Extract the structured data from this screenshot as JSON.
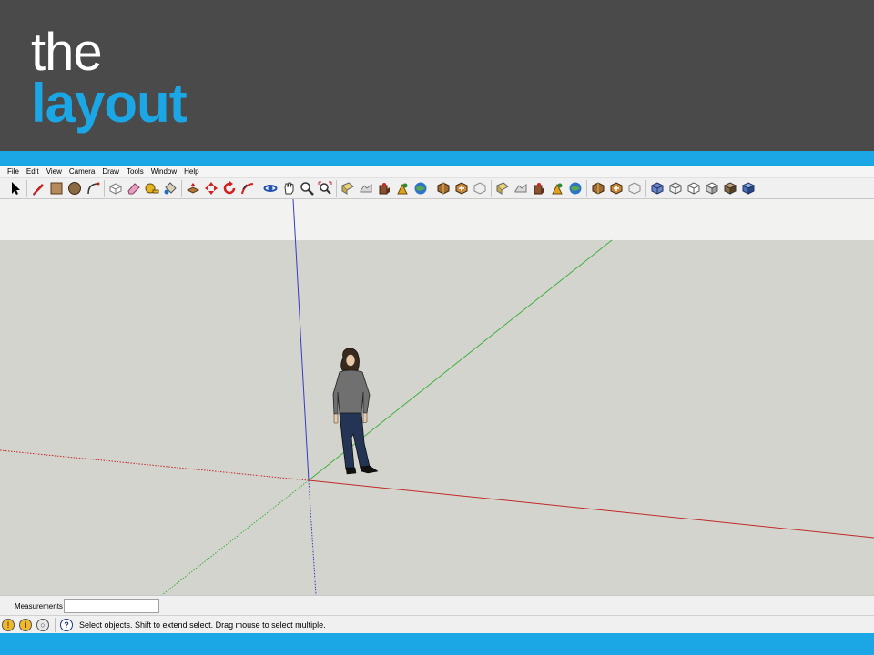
{
  "slide": {
    "title_line1": "the",
    "title_line2": "layout",
    "accent_color": "#1ba7e6",
    "background_color": "#4a4a4a"
  },
  "menubar": {
    "items": [
      "File",
      "Edit",
      "View",
      "Camera",
      "Draw",
      "Tools",
      "Window",
      "Help"
    ]
  },
  "toolbar": {
    "groups": [
      [
        "select-icon"
      ],
      [
        "pencil-line-icon",
        "rectangle-icon",
        "circle-icon",
        "arc-icon"
      ],
      [
        "make-component-icon",
        "eraser-icon",
        "tape-measure-icon",
        "paint-bucket-icon"
      ],
      [
        "push-pull-icon",
        "move-icon",
        "rotate-icon",
        "follow-me-icon"
      ],
      [
        "orbit-icon",
        "pan-icon",
        "zoom-icon",
        "zoom-extents-icon"
      ],
      [
        "add-location-icon",
        "toggle-terrain-icon",
        "get-models-icon",
        "share-model-icon",
        "google-earth-icon"
      ],
      [
        "get-models-icon-2",
        "share-model-icon-2",
        "share-component-icon"
      ],
      [
        "add-location-icon-2",
        "toggle-terrain-icon-2",
        "get-models-icon-3",
        "share-model-icon-3",
        "google-earth-icon-2"
      ],
      [
        "get-models-icon-4",
        "share-model-icon-4",
        "share-component-icon-2"
      ],
      [
        "xray-icon",
        "wireframe-icon",
        "hidden-line-icon",
        "shaded-icon",
        "shaded-textures-icon",
        "monochrome-icon"
      ]
    ]
  },
  "viewport": {
    "axis_colors": {
      "red": "#c03030",
      "green": "#30b030",
      "blue": "#3030c0"
    },
    "figure": "person-figure"
  },
  "measurements": {
    "label": "Measurements",
    "value": ""
  },
  "status": {
    "text": "Select objects. Shift to extend select. Drag mouse to select multiple."
  }
}
